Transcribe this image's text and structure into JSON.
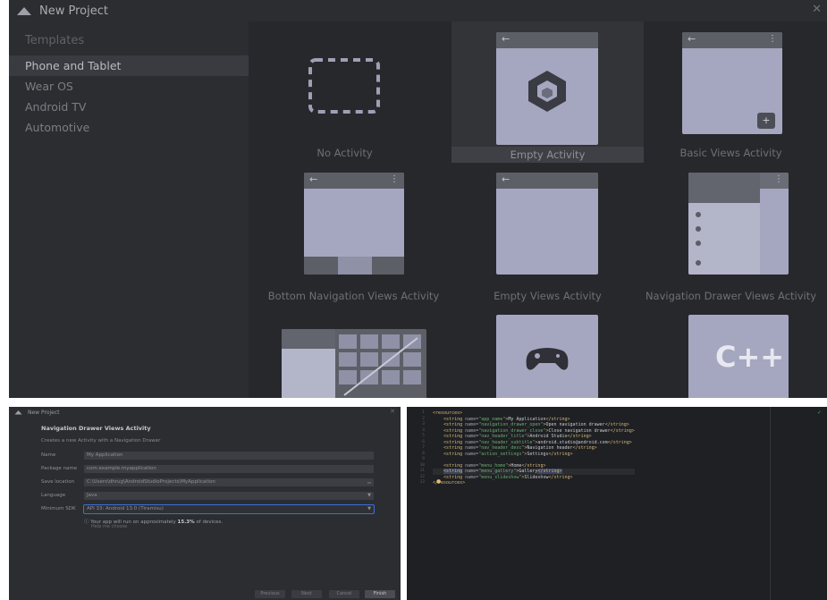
{
  "top": {
    "title": "New Project",
    "sidebar": {
      "heading": "Templates",
      "items": [
        "Phone and Tablet",
        "Wear OS",
        "Android TV",
        "Automotive"
      ],
      "selected_index": 0
    },
    "templates": [
      {
        "name": "No Activity"
      },
      {
        "name": "Empty Activity",
        "selected": true
      },
      {
        "name": "Basic Views Activity"
      },
      {
        "name": "Bottom Navigation Views Activity"
      },
      {
        "name": "Empty Views Activity"
      },
      {
        "name": "Navigation Drawer Views Activity"
      },
      {
        "name": ""
      },
      {
        "name": ""
      },
      {
        "name": ""
      }
    ],
    "glyphs": {
      "back": "←",
      "more": "⋮",
      "plus": "+",
      "cpp": "C++"
    }
  },
  "dialog": {
    "title": "New Project",
    "heading": "Navigation Drawer Views Activity",
    "description": "Creates a new Activity with a Navigation Drawer",
    "fields": {
      "name": {
        "label": "Name",
        "value": "My Application"
      },
      "package": {
        "label": "Package name",
        "value": "com.example.myapplication"
      },
      "location": {
        "label": "Save location",
        "value": "C:\\Users\\dhrug\\AndroidStudioProjects\\MyApplication"
      },
      "language": {
        "label": "Language",
        "value": "Java"
      },
      "min_sdk": {
        "label": "Minimum SDK",
        "value": "API 33: Android 13.0 (Tiramisu)"
      }
    },
    "info_pre": "Your app will run on approximately ",
    "info_pct": "15.3%",
    "info_post": " of devices.",
    "help": "Help me choose",
    "buttons": {
      "previous": "Previous",
      "next": "Next",
      "cancel": "Cancel",
      "finish": "Finish"
    }
  },
  "editor": {
    "line_numbers": [
      "1",
      "2",
      "3",
      "4",
      "5",
      "6",
      "7",
      "8",
      "9",
      "10",
      "11",
      "12",
      "13"
    ],
    "lines": [
      {
        "kind": "open",
        "text": "<resources>"
      },
      {
        "kind": "str",
        "name": "app_name",
        "value": "My Application"
      },
      {
        "kind": "str",
        "name": "navigation_drawer_open",
        "value": "Open navigation drawer"
      },
      {
        "kind": "str",
        "name": "navigation_drawer_close",
        "value": "Close navigation drawer"
      },
      {
        "kind": "str",
        "name": "nav_header_title",
        "value": "Android Studio"
      },
      {
        "kind": "str",
        "name": "nav_header_subtitle",
        "value": "android.studio@android.com"
      },
      {
        "kind": "str",
        "name": "nav_header_desc",
        "value": "Navigation header"
      },
      {
        "kind": "str",
        "name": "action_settings",
        "value": "Settings"
      },
      {
        "kind": "blank",
        "text": ""
      },
      {
        "kind": "str",
        "name": "menu_home",
        "value": "Home"
      },
      {
        "kind": "str",
        "name": "menu_gallery",
        "value": "Gallery",
        "current": true
      },
      {
        "kind": "str",
        "name": "menu_slideshow",
        "value": "Slideshow"
      },
      {
        "kind": "close",
        "text": "</resources>"
      }
    ]
  },
  "colors": {
    "accent": "#3d6fd6",
    "panel": "#2b2d30",
    "tile_phone": "#a5a7c0"
  }
}
